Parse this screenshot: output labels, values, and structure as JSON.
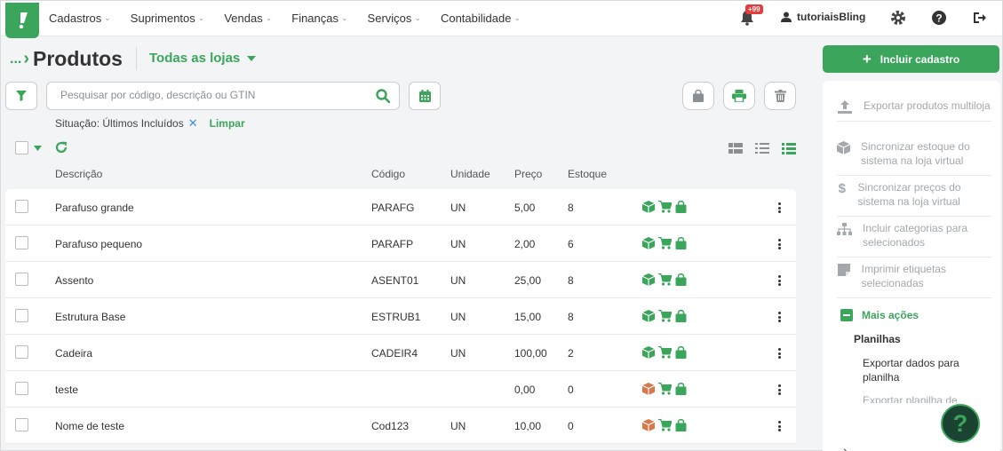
{
  "nav": {
    "menu": [
      "Cadastros",
      "Suprimentos",
      "Vendas",
      "Finanças",
      "Serviços",
      "Contabilidade"
    ],
    "notification_badge": "+99",
    "username": "tutoriaisBling"
  },
  "header": {
    "breadcrumb_dots": "...",
    "title": "Produtos",
    "store_filter": "Todas as lojas"
  },
  "toolbar": {
    "search_placeholder": "Pesquisar por código, descrição ou GTIN",
    "situation_label": "Situação: Últimos Incluídos",
    "clear_label": "Limpar"
  },
  "table": {
    "columns": [
      "Descrição",
      "Código",
      "Unidade",
      "Preço",
      "Estoque"
    ],
    "rows": [
      {
        "descricao": "Parafuso grande",
        "codigo": "PARAFG",
        "unidade": "UN",
        "preco": "5,00",
        "estoque": "8",
        "box_color": "green"
      },
      {
        "descricao": "Parafuso pequeno",
        "codigo": "PARAFP",
        "unidade": "UN",
        "preco": "2,00",
        "estoque": "6",
        "box_color": "green"
      },
      {
        "descricao": "Assento",
        "codigo": "ASENT01",
        "unidade": "UN",
        "preco": "25,00",
        "estoque": "8",
        "box_color": "green"
      },
      {
        "descricao": "Estrutura Base",
        "codigo": "ESTRUB1",
        "unidade": "UN",
        "preco": "15,00",
        "estoque": "8",
        "box_color": "green"
      },
      {
        "descricao": "Cadeira",
        "codigo": "CADEIR4",
        "unidade": "UN",
        "preco": "100,00",
        "estoque": "2",
        "box_color": "green"
      },
      {
        "descricao": "teste",
        "codigo": "",
        "unidade": "",
        "preco": "0,00",
        "estoque": "0",
        "box_color": "orange"
      },
      {
        "descricao": "Nome de teste",
        "codigo": "Cod123",
        "unidade": "UN",
        "preco": "10,00",
        "estoque": "0",
        "box_color": "orange"
      }
    ]
  },
  "sidebar": {
    "add_button": "Incluir cadastro",
    "actions": [
      {
        "label": "Exportar produtos multiloja",
        "icon": "upload-icon"
      },
      {
        "label": "Sincronizar estoque do sistema na loja virtual",
        "icon": "box-icon"
      },
      {
        "label": "Sincronizar preços do sistema na loja virtual",
        "icon": "dollar-icon"
      },
      {
        "label": "Incluir categorias para selecionados",
        "icon": "sitemap-icon"
      },
      {
        "label": "Imprimir etiquetas selecionadas",
        "icon": "label-icon"
      }
    ],
    "more_actions": "Mais ações",
    "spreadsheets_title": "Planilhas",
    "export_spreadsheet": "Exportar dados para planilha",
    "export_spreadsheet_2": "Exportar planilha de"
  },
  "colors": {
    "brand_green": "#3ba55c",
    "box_orange": "#d9774a",
    "badge_red": "#e83b3b"
  }
}
